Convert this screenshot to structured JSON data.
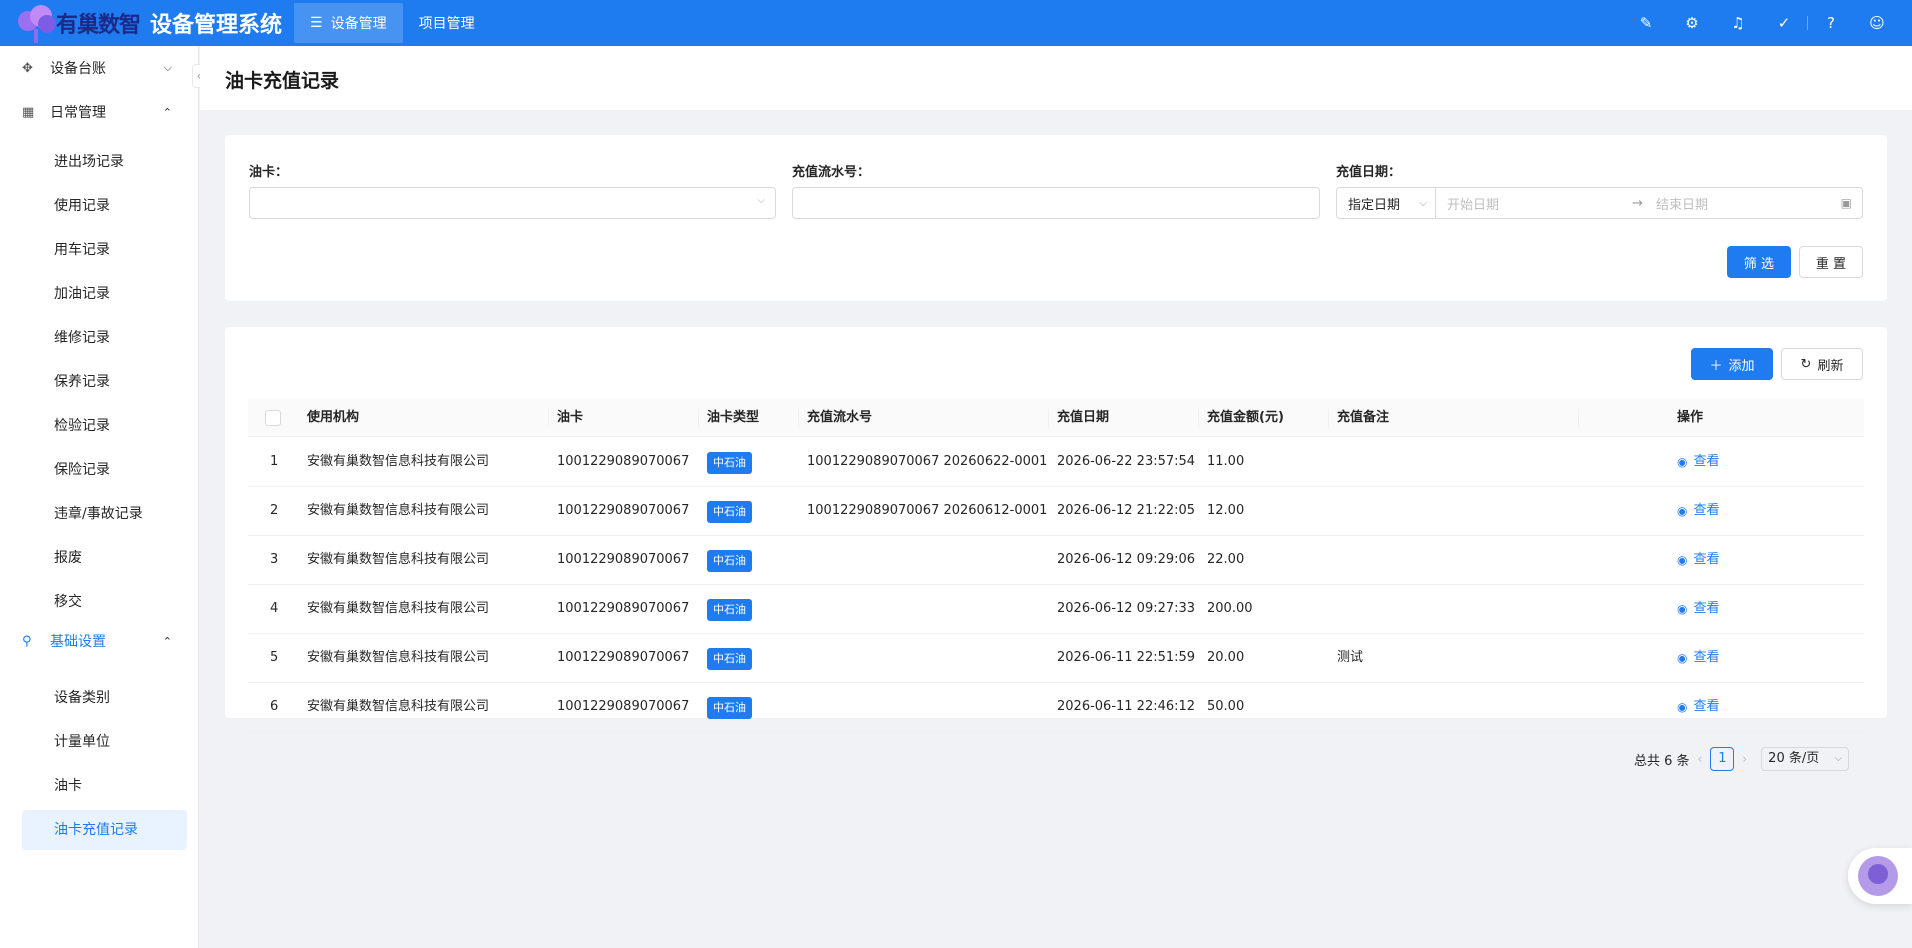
{
  "brand": {
    "logo_text": "有巢数智",
    "system_title": "设备管理系统"
  },
  "topnav": [
    {
      "label": "设备管理",
      "active": true,
      "icon": "list-icon"
    },
    {
      "label": "项目管理",
      "active": false
    }
  ],
  "top_icons": [
    "brush-icon",
    "gear-icon",
    "bell-icon",
    "check-circle-icon",
    "help-icon",
    "user-icon"
  ],
  "sidebar": {
    "groups": [
      {
        "label": "设备台账",
        "icon": "grid-icon",
        "expanded": false
      },
      {
        "label": "日常管理",
        "icon": "layout-icon",
        "expanded": true,
        "items": [
          "进出场记录",
          "使用记录",
          "用车记录",
          "加油记录",
          "维修记录",
          "保养记录",
          "检验记录",
          "保险记录",
          "违章/事故记录",
          "报废",
          "移交"
        ]
      },
      {
        "label": "基础设置",
        "icon": "link-icon",
        "expanded": true,
        "active": true,
        "items": [
          "设备类别",
          "计量单位",
          "油卡",
          "油卡充值记录"
        ]
      }
    ],
    "active_item": "油卡充值记录"
  },
  "page": {
    "title": "油卡充值记录"
  },
  "filters": {
    "card_label": "油卡：",
    "card_value": "",
    "serial_label": "充值流水号：",
    "serial_value": "",
    "date_label": "充值日期：",
    "date_type": "指定日期",
    "start_placeholder": "开始日期",
    "end_placeholder": "结束日期",
    "range_arrow": "→",
    "search_button": "筛 选",
    "reset_button": "重 置"
  },
  "toolbar": {
    "add_button": "添加",
    "refresh_button": "刷新"
  },
  "table": {
    "columns": [
      "使用机构",
      "油卡",
      "油卡类型",
      "充值流水号",
      "充值日期",
      "充值金额(元)",
      "充值备注",
      "操作"
    ],
    "view_label": "查看",
    "rows": [
      {
        "index": "1",
        "org": "安徽有巢数智信息科技有限公司",
        "card": "1001229089070067",
        "type": "中石油",
        "serial": "1001229089070067 20260622-0001",
        "date": "2026-06-22 23:57:54",
        "amount": "11.00",
        "remark": ""
      },
      {
        "index": "2",
        "org": "安徽有巢数智信息科技有限公司",
        "card": "1001229089070067",
        "type": "中石油",
        "serial": "1001229089070067 20260612-0001",
        "date": "2026-06-12 21:22:05",
        "amount": "12.00",
        "remark": ""
      },
      {
        "index": "3",
        "org": "安徽有巢数智信息科技有限公司",
        "card": "1001229089070067",
        "type": "中石油",
        "serial": "",
        "date": "2026-06-12 09:29:06",
        "amount": "22.00",
        "remark": ""
      },
      {
        "index": "4",
        "org": "安徽有巢数智信息科技有限公司",
        "card": "1001229089070067",
        "type": "中石油",
        "serial": "",
        "date": "2026-06-12 09:27:33",
        "amount": "200.00",
        "remark": ""
      },
      {
        "index": "5",
        "org": "安徽有巢数智信息科技有限公司",
        "card": "1001229089070067",
        "type": "中石油",
        "serial": "",
        "date": "2026-06-11 22:51:59",
        "amount": "20.00",
        "remark": "测试"
      },
      {
        "index": "6",
        "org": "安徽有巢数智信息科技有限公司",
        "card": "1001229089070067",
        "type": "中石油",
        "serial": "",
        "date": "2026-06-11 22:46:12",
        "amount": "50.00",
        "remark": ""
      }
    ]
  },
  "pagination": {
    "total_text": "总共 6 条",
    "current_page": "1",
    "page_size": "20 条/页"
  },
  "colors": {
    "primary": "#1f7cf0",
    "active_bg": "#e8f3ff"
  }
}
